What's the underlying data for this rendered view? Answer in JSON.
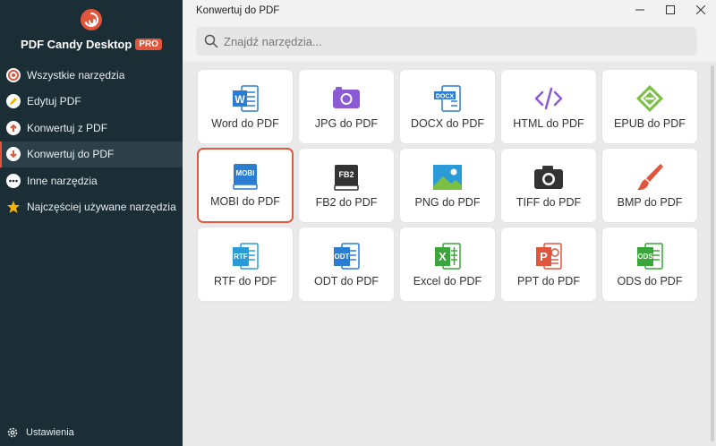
{
  "app": {
    "name": "PDF Candy Desktop",
    "badge": "PRO",
    "window_title": "Konwertuj do PDF"
  },
  "sidebar": {
    "items": [
      {
        "label": "Wszystkie narzędzia",
        "icon": "target-icon",
        "color": "#e2553d"
      },
      {
        "label": "Edytuj PDF",
        "icon": "edit-icon",
        "color": "#f4b400"
      },
      {
        "label": "Konwertuj z PDF",
        "icon": "convert-from-icon",
        "color": "#e2553d"
      },
      {
        "label": "Konwertuj do PDF",
        "icon": "convert-to-icon",
        "color": "#e2553d",
        "active": true
      },
      {
        "label": "Inne narzędzia",
        "icon": "more-icon",
        "color": "#ffffff"
      },
      {
        "label": "Najczęściej używane narzędzia",
        "icon": "star-icon",
        "color": "#f4b400"
      }
    ],
    "settings_label": "Ustawienia"
  },
  "search": {
    "placeholder": "Znajdź narzędzia..."
  },
  "tools": [
    {
      "label": "Word do PDF",
      "icon": "word-icon",
      "color": "#2b7cd3"
    },
    {
      "label": "JPG do PDF",
      "icon": "camera-icon",
      "color": "#8b5bd6"
    },
    {
      "label": "DOCX do PDF",
      "icon": "docx-icon",
      "color": "#2b7cd3"
    },
    {
      "label": "HTML do PDF",
      "icon": "code-icon",
      "color": "#8b5bd6"
    },
    {
      "label": "EPUB do PDF",
      "icon": "epub-icon",
      "color": "#7ac143"
    },
    {
      "label": "MOBI do PDF",
      "icon": "mobi-icon",
      "color": "#2b7cd3",
      "selected": true
    },
    {
      "label": "FB2 do PDF",
      "icon": "fb2-icon",
      "color": "#333333"
    },
    {
      "label": "PNG do PDF",
      "icon": "image-icon",
      "color": "#2b9bd8"
    },
    {
      "label": "TIFF do PDF",
      "icon": "camera-icon",
      "color": "#333333"
    },
    {
      "label": "BMP do PDF",
      "icon": "brush-icon",
      "color": "#e2553d"
    },
    {
      "label": "RTF do PDF",
      "icon": "rtf-icon",
      "color": "#2b9bd8"
    },
    {
      "label": "ODT do PDF",
      "icon": "odt-icon",
      "color": "#2b7cd3"
    },
    {
      "label": "Excel do PDF",
      "icon": "excel-icon",
      "color": "#3aa53a"
    },
    {
      "label": "PPT do PDF",
      "icon": "ppt-icon",
      "color": "#e2553d"
    },
    {
      "label": "ODS do PDF",
      "icon": "ods-icon",
      "color": "#3aa53a"
    }
  ],
  "icon_text": {
    "docx": "DOCX",
    "mobi": "MOBI",
    "fb2": "FB2",
    "rtf": "RTF",
    "odt": "ODT",
    "ods": "ODS",
    "word": "W",
    "excel": "X",
    "ppt": "P"
  }
}
